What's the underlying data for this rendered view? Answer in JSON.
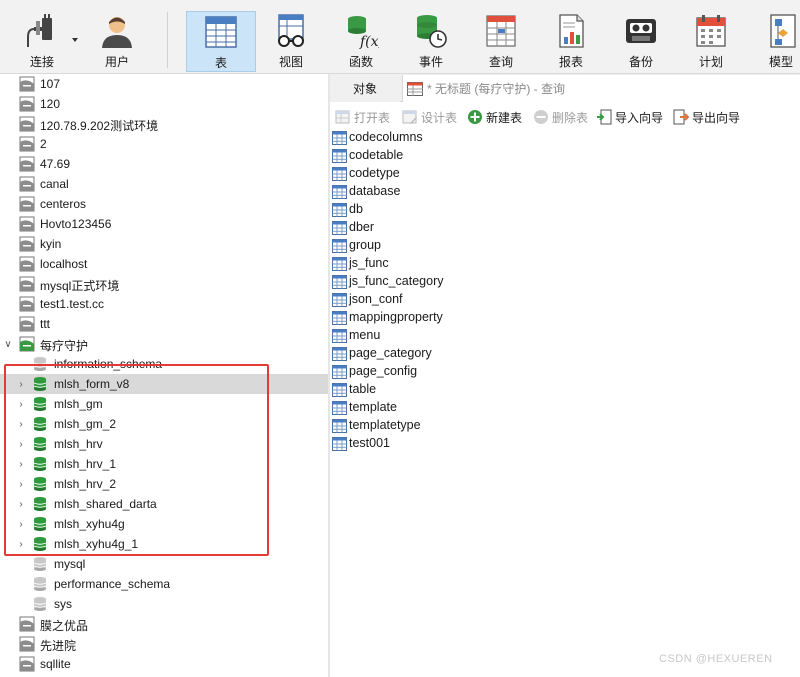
{
  "toolbar": {
    "buttons": [
      {
        "label": "连接",
        "icon": "plug-icon"
      },
      {
        "label": "用户",
        "icon": "user-icon"
      },
      {
        "label": "表",
        "icon": "table-icon"
      },
      {
        "label": "视图",
        "icon": "view-glasses-icon"
      },
      {
        "label": "函数",
        "icon": "function-icon"
      },
      {
        "label": "事件",
        "icon": "event-clock-icon"
      },
      {
        "label": "查询",
        "icon": "query-grid-icon"
      },
      {
        "label": "报表",
        "icon": "report-icon"
      },
      {
        "label": "备份",
        "icon": "backup-tape-icon"
      },
      {
        "label": "计划",
        "icon": "calendar-icon"
      },
      {
        "label": "模型",
        "icon": "model-icon"
      }
    ]
  },
  "tree": {
    "connections_top": [
      "107",
      "120",
      "120.78.9.202测试环境",
      "2",
      "47.69",
      "canal",
      "centeros",
      "Hovto123456",
      "kyin",
      "localhost",
      "mysql正式环境",
      "test1.test.cc",
      "ttt"
    ],
    "open_connection": "每疗守护",
    "databases": [
      {
        "name": "information_schema",
        "open": false,
        "expandable": false
      },
      {
        "name": "mlsh_form_v8",
        "open": true,
        "expandable": true,
        "selected": true
      },
      {
        "name": "mlsh_gm",
        "open": true,
        "expandable": true
      },
      {
        "name": "mlsh_gm_2",
        "open": true,
        "expandable": true
      },
      {
        "name": "mlsh_hrv",
        "open": true,
        "expandable": true
      },
      {
        "name": "mlsh_hrv_1",
        "open": true,
        "expandable": true
      },
      {
        "name": "mlsh_hrv_2",
        "open": true,
        "expandable": true
      },
      {
        "name": "mlsh_shared_darta",
        "open": true,
        "expandable": true
      },
      {
        "name": "mlsh_xyhu4g",
        "open": true,
        "expandable": true
      },
      {
        "name": "mlsh_xyhu4g_1",
        "open": true,
        "expandable": true
      },
      {
        "name": "mysql",
        "open": false,
        "expandable": false
      },
      {
        "name": "performance_schema",
        "open": false,
        "expandable": false
      },
      {
        "name": "sys",
        "open": false,
        "expandable": false
      }
    ],
    "connections_bottom": [
      "膜之优品",
      "先进院",
      "sqllite"
    ]
  },
  "right": {
    "tab_objects": "对象",
    "tab_query": "* 无标题 (每疗守护) - 查询",
    "object_toolbar": [
      {
        "label": "打开表",
        "enabled": false
      },
      {
        "label": "设计表",
        "enabled": false
      },
      {
        "label": "新建表",
        "enabled": true
      },
      {
        "label": "删除表",
        "enabled": false
      },
      {
        "label": "导入向导",
        "enabled": true
      },
      {
        "label": "导出向导",
        "enabled": true
      }
    ],
    "tables": [
      "codecolumns",
      "codetable",
      "codetype",
      "database",
      "db",
      "dber",
      "group",
      "js_func",
      "js_func_category",
      "json_conf",
      "mappingproperty",
      "menu",
      "page_category",
      "page_config",
      "table",
      "template",
      "templatetype",
      "test001"
    ]
  },
  "colors": {
    "accent_selected_toolbar": "#cce4f7",
    "db_open_green": "#2e9a3c",
    "highlight_box": "#e53935"
  },
  "watermark": "CSDN @HEXUEREN"
}
